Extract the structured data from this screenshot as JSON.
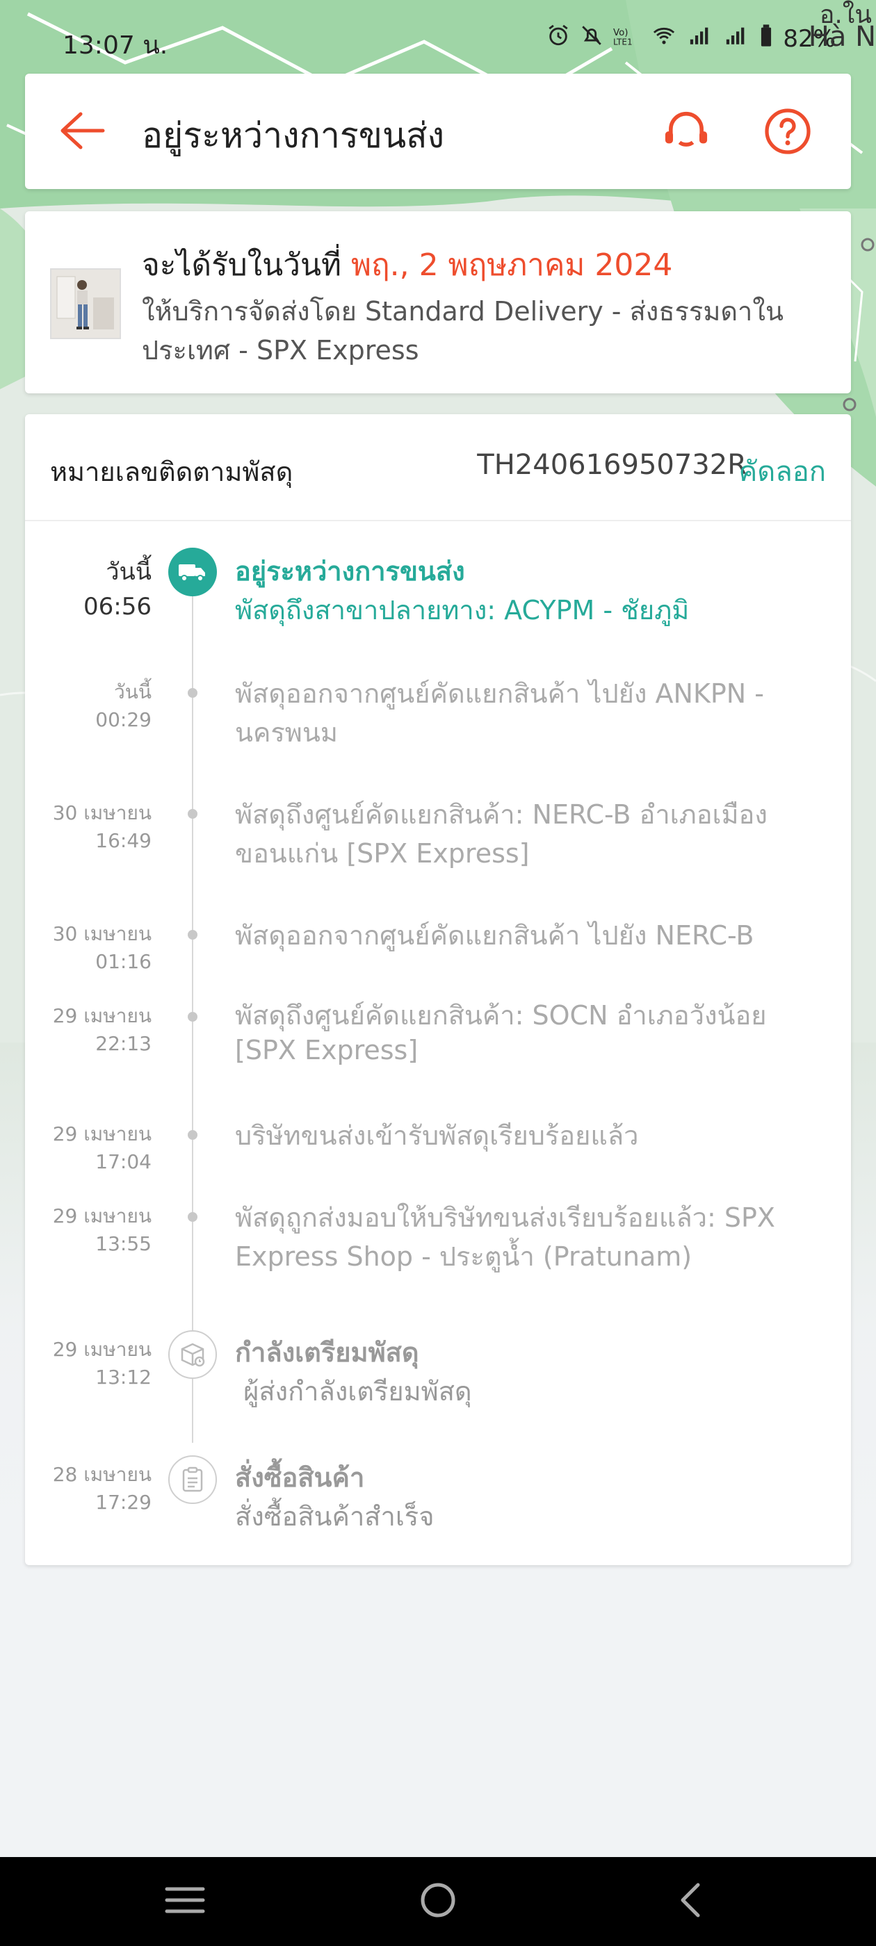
{
  "status_bar": {
    "time": "13:07 น.",
    "battery": "82%",
    "map_city_top": "อ.ใน",
    "map_city": "Hà N"
  },
  "header": {
    "title": "อยู่ระหว่างการขนส่ง"
  },
  "delivery": {
    "eta_prefix": "จะได้รับในวันที่",
    "eta_date": "พฤ., 2 พฤษภาคม 2024",
    "provider": "ให้บริการจัดส่งโดย Standard Delivery - ส่งธรรมดาในประเทศ - SPX Express"
  },
  "tracking": {
    "label": "หมายเลขติดตามพัสดุ",
    "number": "TH240616950732R",
    "copy_label": "คัดลอก",
    "events": [
      {
        "date": "วันนี้",
        "time": "06:56",
        "title": "อยู่ระหว่างการขนส่ง",
        "text": "พัสดุถึงสาขาปลายทาง: ACYPM - ชัยภูมิ"
      },
      {
        "date": "วันนี้",
        "time": "00:29",
        "text": "พัสดุออกจากศูนย์คัดแยกสินค้า ไปยัง ANKPN - นครพนม"
      },
      {
        "date": "30 เมษายน",
        "time": "16:49",
        "text": "พัสดุถึงศูนย์คัดแยกสินค้า: NERC-B อำเภอเมืองขอนแก่น [SPX Express]"
      },
      {
        "date": "30 เมษายน",
        "time": "01:16",
        "text": "พัสดุออกจากศูนย์คัดแยกสินค้า ไปยัง NERC-B"
      },
      {
        "date": "29 เมษายน",
        "time": "22:13",
        "text": "พัสดุถึงศูนย์คัดแยกสินค้า: SOCN อำเภอวังน้อย [SPX Express]"
      },
      {
        "date": "29 เมษายน",
        "time": "17:04",
        "text": "บริษัทขนส่งเข้ารับพัสดุเรียบร้อยแล้ว"
      },
      {
        "date": "29 เมษายน",
        "time": "13:55",
        "text": "พัสดุถูกส่งมอบให้บริษัทขนส่งเรียบร้อยแล้ว: SPX Express Shop - ประตูน้ำ (Pratunam)"
      },
      {
        "date": "29 เมษายน",
        "time": "13:12",
        "title": "กำลังเตรียมพัสดุ",
        "text": " ผู้ส่งกำลังเตรียมพัสดุ"
      },
      {
        "date": "28 เมษายน",
        "time": "17:29",
        "title": "สั่งซื้อสินค้า",
        "text": "สั่งซื้อสินค้าสำเร็จ"
      }
    ]
  },
  "colors": {
    "accent": "#ee4d2d",
    "teal": "#26aa99",
    "muted_text": "#aaaaaa"
  },
  "icons": {
    "back": "arrow-left-icon",
    "support": "headset-icon",
    "help": "question-icon",
    "truck": "truck-icon",
    "package": "package-icon",
    "order": "clipboard-icon"
  }
}
